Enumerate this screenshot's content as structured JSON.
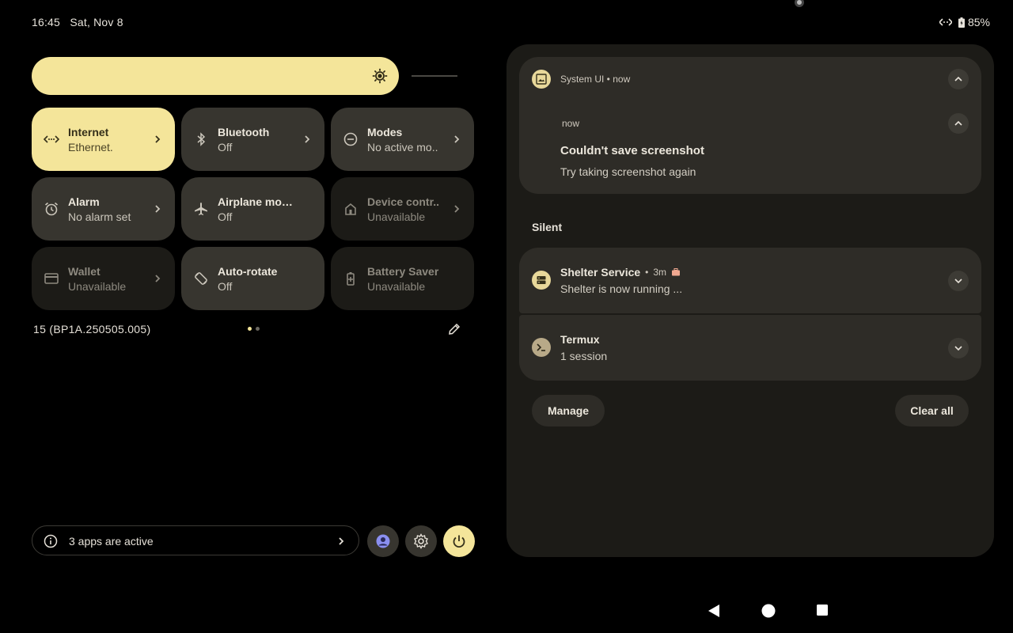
{
  "status_bar": {
    "time": "16:45",
    "date": "Sat, Nov 8",
    "battery": "85%"
  },
  "brightness": {
    "level": 0.9
  },
  "tiles": [
    {
      "title": "Internet",
      "subtitle": "Ethernet.",
      "icon": "ethernet-icon",
      "state": "on"
    },
    {
      "title": "Bluetooth",
      "subtitle": "Off",
      "icon": "bluetooth-icon",
      "state": "off"
    },
    {
      "title": "Modes",
      "subtitle": "No active mo..",
      "icon": "modes-icon",
      "state": "off"
    },
    {
      "title": "Alarm",
      "subtitle": "No alarm set",
      "icon": "alarm-icon",
      "state": "off"
    },
    {
      "title": "Airplane mode",
      "subtitle": "Off",
      "icon": "airplane-icon",
      "state": "off"
    },
    {
      "title": "Device contr..",
      "subtitle": "Unavailable",
      "icon": "home-icon",
      "state": "unavailable"
    },
    {
      "title": "Wallet",
      "subtitle": "Unavailable",
      "icon": "wallet-icon",
      "state": "unavailable"
    },
    {
      "title": "Auto-rotate",
      "subtitle": "Off",
      "icon": "rotate-icon",
      "state": "off"
    },
    {
      "title": "Battery Saver",
      "subtitle": "Unavailable",
      "icon": "battery-saver-icon",
      "state": "unavailable"
    }
  ],
  "build": "15 (BP1A.250505.005)",
  "pages": {
    "current": 1,
    "total": 2
  },
  "footer": {
    "active_apps": "3 apps are active"
  },
  "notifications": {
    "system_ui": {
      "app": "System UI",
      "time": "now",
      "inner_time": "now",
      "title": "Couldn't save screenshot",
      "text": "Try taking screenshot again"
    },
    "silent_header": "Silent",
    "shelter": {
      "app": "Shelter Service",
      "time": "3m",
      "text": "Shelter is now running ..."
    },
    "termux": {
      "app": "Termux",
      "text": "1 session"
    },
    "manage": "Manage",
    "clear_all": "Clear all"
  },
  "colors": {
    "accent": "#f4e59a",
    "tile": "#37352f",
    "panel": "#1c1b17",
    "card": "#2e2c27"
  }
}
